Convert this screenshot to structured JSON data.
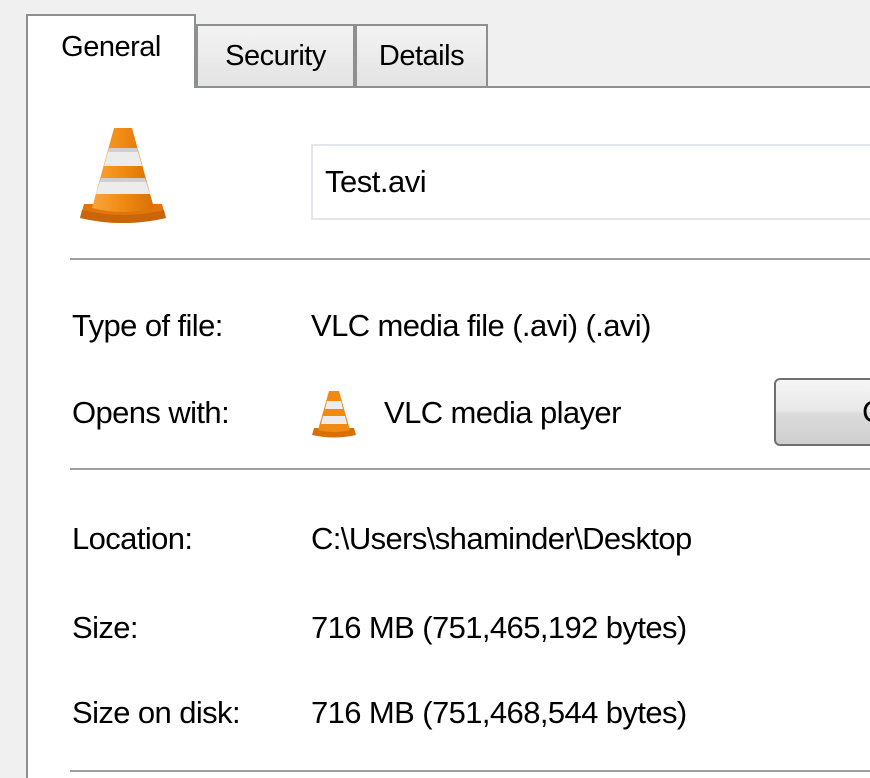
{
  "tabs": [
    {
      "label": "General",
      "active": true
    },
    {
      "label": "Security",
      "active": false
    },
    {
      "label": "Details",
      "active": false
    }
  ],
  "file": {
    "name": "Test.avi",
    "icon": "vlc-cone-icon"
  },
  "type_row": {
    "label": "Type of file:",
    "value": "VLC media file (.avi) (.avi)"
  },
  "opens_row": {
    "label": "Opens with:",
    "app_name": "VLC media player",
    "app_icon": "vlc-cone-icon",
    "change_label": "C"
  },
  "location_row": {
    "label": "Location:",
    "value": "C:\\Users\\shaminder\\Desktop"
  },
  "size_row": {
    "label": "Size:",
    "value": "716 MB (751,465,192 bytes)"
  },
  "size_on_disk_row": {
    "label": "Size on disk:",
    "value": "716 MB (751,468,544 bytes)"
  },
  "colors": {
    "cone_orange": "#f08a12",
    "cone_stripe": "#e8e8e8",
    "panel_bg": "#ffffff",
    "window_bg": "#f0f0f0"
  }
}
